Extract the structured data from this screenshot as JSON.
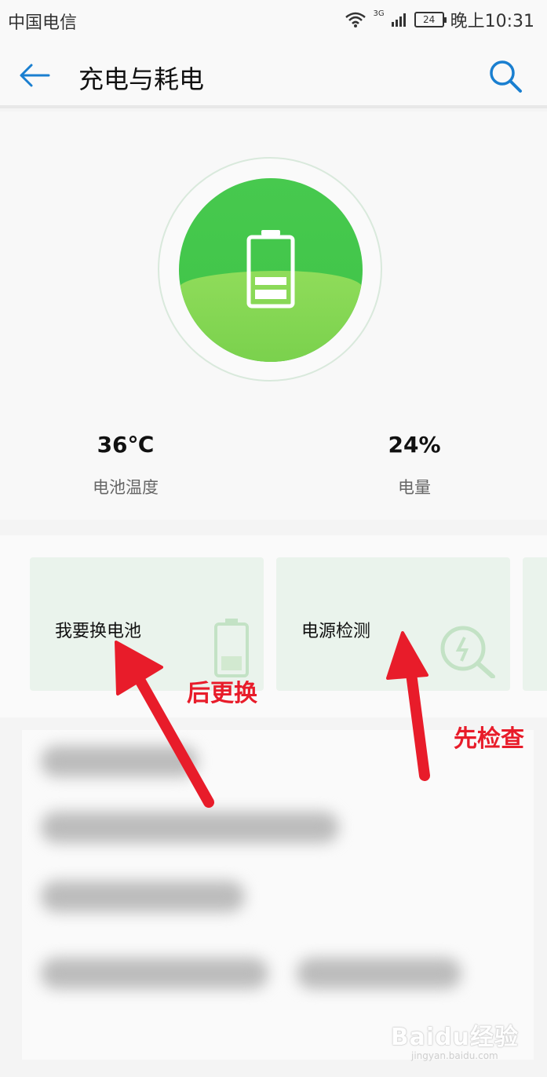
{
  "status_bar": {
    "carrier": "中国电信",
    "network": "3G",
    "battery_level": "24",
    "time": "晚上10:31"
  },
  "app_bar": {
    "title": "充电与耗电"
  },
  "stats": [
    {
      "value": "36℃",
      "label": "电池温度"
    },
    {
      "value": "24%",
      "label": "电量"
    }
  ],
  "cards": [
    {
      "label": "我要换电池",
      "icon": "battery-icon"
    },
    {
      "label": "电源检测",
      "icon": "power-check-icon"
    }
  ],
  "annotations": {
    "left_note": "后更换",
    "right_note": "先检查"
  },
  "watermark": {
    "text": "Baidu经验",
    "sub": "jingyan.baidu.com"
  },
  "colors": {
    "accent": "#1a7fd0",
    "gauge_green": "#47c94e",
    "note_red": "#e81c2a"
  }
}
